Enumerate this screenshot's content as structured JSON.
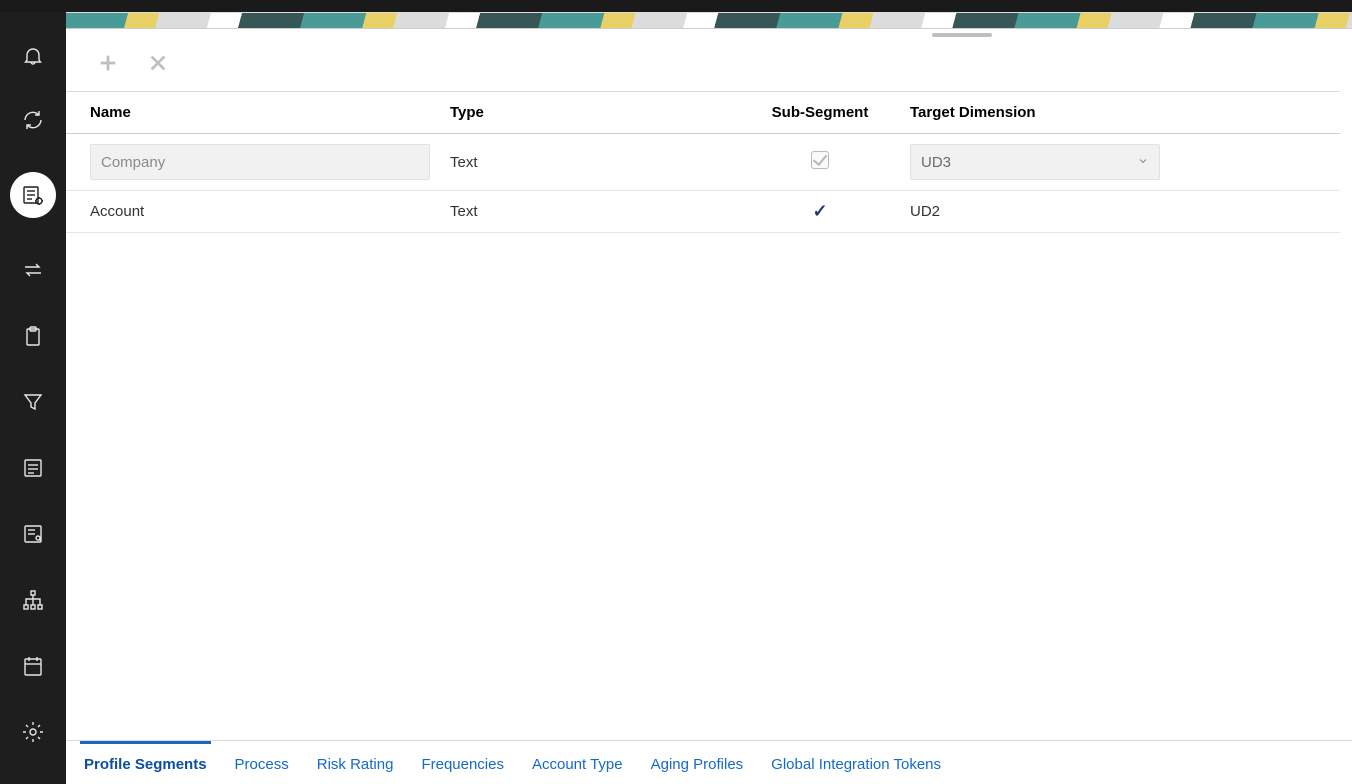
{
  "sidebar": {
    "items": [
      {
        "name": "notifications",
        "icon": "bell"
      },
      {
        "name": "refresh",
        "icon": "refresh"
      },
      {
        "name": "configure-lists",
        "icon": "list-gear",
        "active": true
      },
      {
        "name": "transfer",
        "icon": "swap"
      },
      {
        "name": "clipboard",
        "icon": "clipboard"
      },
      {
        "name": "filter",
        "icon": "funnel"
      },
      {
        "name": "notes",
        "icon": "notes"
      },
      {
        "name": "review",
        "icon": "review"
      },
      {
        "name": "hierarchy",
        "icon": "hierarchy"
      },
      {
        "name": "calendar",
        "icon": "calendar"
      },
      {
        "name": "settings",
        "icon": "gear"
      }
    ]
  },
  "table": {
    "headers": {
      "name": "Name",
      "type": "Type",
      "subsegment": "Sub-Segment",
      "target": "Target Dimension"
    },
    "rows": [
      {
        "editing": true,
        "name_placeholder": "Company",
        "name_value": "",
        "type": "Text",
        "subsegment_checked": true,
        "subsegment_disabled": true,
        "target": "UD3"
      },
      {
        "editing": false,
        "name": "Account",
        "type": "Text",
        "subsegment_checked": true,
        "subsegment_disabled": false,
        "target": "UD2"
      }
    ]
  },
  "tabs": [
    {
      "id": "profile-segments",
      "label": "Profile Segments",
      "active": true
    },
    {
      "id": "process",
      "label": "Process"
    },
    {
      "id": "risk-rating",
      "label": "Risk Rating"
    },
    {
      "id": "frequencies",
      "label": "Frequencies"
    },
    {
      "id": "account-type",
      "label": "Account Type"
    },
    {
      "id": "aging-profiles",
      "label": "Aging Profiles"
    },
    {
      "id": "global-integration-tokens",
      "label": "Global Integration Tokens"
    }
  ]
}
